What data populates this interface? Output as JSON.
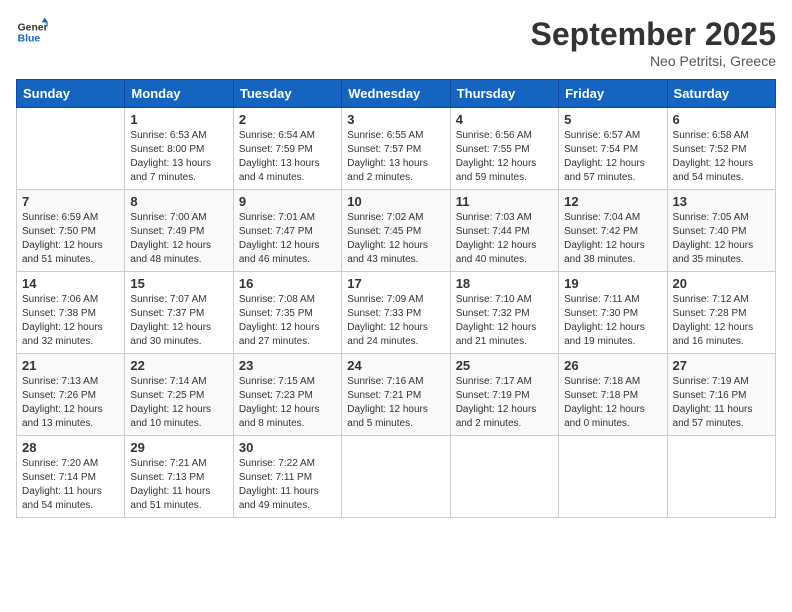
{
  "logo": {
    "line1": "General",
    "line2": "Blue"
  },
  "title": "September 2025",
  "subtitle": "Neo Petritsi, Greece",
  "days_of_week": [
    "Sunday",
    "Monday",
    "Tuesday",
    "Wednesday",
    "Thursday",
    "Friday",
    "Saturday"
  ],
  "weeks": [
    [
      {
        "num": "",
        "info": ""
      },
      {
        "num": "1",
        "info": "Sunrise: 6:53 AM\nSunset: 8:00 PM\nDaylight: 13 hours\nand 7 minutes."
      },
      {
        "num": "2",
        "info": "Sunrise: 6:54 AM\nSunset: 7:59 PM\nDaylight: 13 hours\nand 4 minutes."
      },
      {
        "num": "3",
        "info": "Sunrise: 6:55 AM\nSunset: 7:57 PM\nDaylight: 13 hours\nand 2 minutes."
      },
      {
        "num": "4",
        "info": "Sunrise: 6:56 AM\nSunset: 7:55 PM\nDaylight: 12 hours\nand 59 minutes."
      },
      {
        "num": "5",
        "info": "Sunrise: 6:57 AM\nSunset: 7:54 PM\nDaylight: 12 hours\nand 57 minutes."
      },
      {
        "num": "6",
        "info": "Sunrise: 6:58 AM\nSunset: 7:52 PM\nDaylight: 12 hours\nand 54 minutes."
      }
    ],
    [
      {
        "num": "7",
        "info": "Sunrise: 6:59 AM\nSunset: 7:50 PM\nDaylight: 12 hours\nand 51 minutes."
      },
      {
        "num": "8",
        "info": "Sunrise: 7:00 AM\nSunset: 7:49 PM\nDaylight: 12 hours\nand 48 minutes."
      },
      {
        "num": "9",
        "info": "Sunrise: 7:01 AM\nSunset: 7:47 PM\nDaylight: 12 hours\nand 46 minutes."
      },
      {
        "num": "10",
        "info": "Sunrise: 7:02 AM\nSunset: 7:45 PM\nDaylight: 12 hours\nand 43 minutes."
      },
      {
        "num": "11",
        "info": "Sunrise: 7:03 AM\nSunset: 7:44 PM\nDaylight: 12 hours\nand 40 minutes."
      },
      {
        "num": "12",
        "info": "Sunrise: 7:04 AM\nSunset: 7:42 PM\nDaylight: 12 hours\nand 38 minutes."
      },
      {
        "num": "13",
        "info": "Sunrise: 7:05 AM\nSunset: 7:40 PM\nDaylight: 12 hours\nand 35 minutes."
      }
    ],
    [
      {
        "num": "14",
        "info": "Sunrise: 7:06 AM\nSunset: 7:38 PM\nDaylight: 12 hours\nand 32 minutes."
      },
      {
        "num": "15",
        "info": "Sunrise: 7:07 AM\nSunset: 7:37 PM\nDaylight: 12 hours\nand 30 minutes."
      },
      {
        "num": "16",
        "info": "Sunrise: 7:08 AM\nSunset: 7:35 PM\nDaylight: 12 hours\nand 27 minutes."
      },
      {
        "num": "17",
        "info": "Sunrise: 7:09 AM\nSunset: 7:33 PM\nDaylight: 12 hours\nand 24 minutes."
      },
      {
        "num": "18",
        "info": "Sunrise: 7:10 AM\nSunset: 7:32 PM\nDaylight: 12 hours\nand 21 minutes."
      },
      {
        "num": "19",
        "info": "Sunrise: 7:11 AM\nSunset: 7:30 PM\nDaylight: 12 hours\nand 19 minutes."
      },
      {
        "num": "20",
        "info": "Sunrise: 7:12 AM\nSunset: 7:28 PM\nDaylight: 12 hours\nand 16 minutes."
      }
    ],
    [
      {
        "num": "21",
        "info": "Sunrise: 7:13 AM\nSunset: 7:26 PM\nDaylight: 12 hours\nand 13 minutes."
      },
      {
        "num": "22",
        "info": "Sunrise: 7:14 AM\nSunset: 7:25 PM\nDaylight: 12 hours\nand 10 minutes."
      },
      {
        "num": "23",
        "info": "Sunrise: 7:15 AM\nSunset: 7:23 PM\nDaylight: 12 hours\nand 8 minutes."
      },
      {
        "num": "24",
        "info": "Sunrise: 7:16 AM\nSunset: 7:21 PM\nDaylight: 12 hours\nand 5 minutes."
      },
      {
        "num": "25",
        "info": "Sunrise: 7:17 AM\nSunset: 7:19 PM\nDaylight: 12 hours\nand 2 minutes."
      },
      {
        "num": "26",
        "info": "Sunrise: 7:18 AM\nSunset: 7:18 PM\nDaylight: 12 hours\nand 0 minutes."
      },
      {
        "num": "27",
        "info": "Sunrise: 7:19 AM\nSunset: 7:16 PM\nDaylight: 11 hours\nand 57 minutes."
      }
    ],
    [
      {
        "num": "28",
        "info": "Sunrise: 7:20 AM\nSunset: 7:14 PM\nDaylight: 11 hours\nand 54 minutes."
      },
      {
        "num": "29",
        "info": "Sunrise: 7:21 AM\nSunset: 7:13 PM\nDaylight: 11 hours\nand 51 minutes."
      },
      {
        "num": "30",
        "info": "Sunrise: 7:22 AM\nSunset: 7:11 PM\nDaylight: 11 hours\nand 49 minutes."
      },
      {
        "num": "",
        "info": ""
      },
      {
        "num": "",
        "info": ""
      },
      {
        "num": "",
        "info": ""
      },
      {
        "num": "",
        "info": ""
      }
    ]
  ]
}
